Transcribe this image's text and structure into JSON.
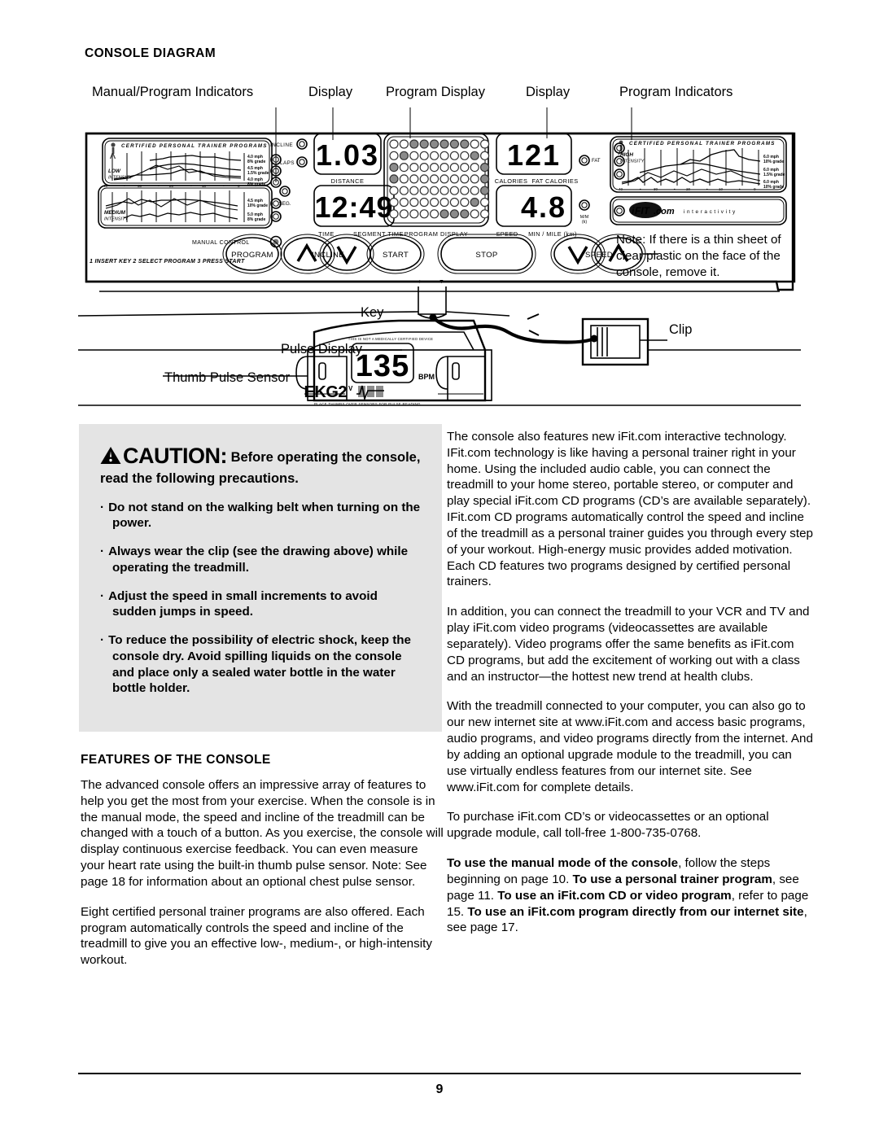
{
  "page": {
    "number": "9"
  },
  "sections": {
    "console_diagram_title": "CONSOLE DIAGRAM",
    "features_title": "FEATURES OF THE CONSOLE"
  },
  "callouts": {
    "manual_program_indicators": "Manual/Program Indicators",
    "display_left": "Display",
    "program_display": "Program Display",
    "display_right": "Display",
    "program_indicators": "Program Indicators",
    "key": "Key",
    "clip": "Clip",
    "pulse_display": "Pulse Display",
    "thumb_pulse_sensor": "Thumb Pulse Sensor"
  },
  "console": {
    "note": "Note: If there is a thin sheet of clear plastic on the face of the console, remove it.",
    "banner": "C E R T I F I E D   P E R S O N A L   T R A I N E R   P R O G R A M S",
    "instruction_strip": "1 INSERT KEY 2 SELECT PROGRAM 3 PRESS START",
    "manual_control_label": "MANUAL CONTROL",
    "intensity_low": "LOW",
    "intensity_low_sub": "INTENSITY",
    "intensity_medium": "MEDIUM",
    "intensity_medium_sub": "INTENSITY",
    "intensity_high": "HIGH",
    "intensity_high_sub": "INTENSITY",
    "ifit_logo": "iFIT.com",
    "ifit_tag": "i n t e r a c t i v i t y",
    "program_specs_low": [
      {
        "speed": "4.0 mph",
        "grade": "8% grade"
      },
      {
        "speed": "4.5 mph",
        "grade": "1.5% grade"
      },
      {
        "speed": "4.0 mph",
        "grade": "8% grade"
      }
    ],
    "program_specs_medium": [
      {
        "speed": "4.5 mph",
        "grade": "10% grade"
      },
      {
        "speed": "5.0 mph",
        "grade": "8% grade"
      }
    ],
    "program_specs_high": [
      {
        "speed": "6.0 mph",
        "grade": "10% grade"
      },
      {
        "speed": "6.0 mph",
        "grade": "1.5% grade"
      },
      {
        "speed": "6.0 mph",
        "grade": "10% grade"
      }
    ],
    "graph_axis_ticks": [
      "40",
      "30",
      "20",
      "10",
      "0"
    ],
    "indicator_labels": {
      "incline": "INCLINE",
      "laps": "LAPS",
      "seg": "SEG.",
      "fat": "FAT",
      "mm_k": "M/M (k)"
    },
    "displays": {
      "distance_value": "1.03",
      "distance_label": "DISTANCE",
      "time_value": "12:49",
      "time_label": "TIME",
      "segment_time_label": "SEGMENT TIME",
      "calories_value": "121",
      "calories_label": "CALORIES",
      "fat_calories_label": "FAT CALORIES",
      "speed_value": "4.8",
      "speed_label": "SPEED",
      "min_mile_label": "MIN / MILE (km)",
      "program_display_label": "PROGRAM DISPLAY"
    },
    "buttons": {
      "program": "PROGRAM",
      "incline": "INCLINE",
      "start": "START",
      "stop": "STOP",
      "speed": "SPEED"
    },
    "program_display_dots": [
      [
        0,
        0,
        1,
        1,
        1,
        1,
        1,
        1,
        0,
        0
      ],
      [
        0,
        1,
        0,
        0,
        0,
        0,
        0,
        0,
        1,
        0
      ],
      [
        1,
        0,
        0,
        0,
        0,
        0,
        0,
        0,
        0,
        1
      ],
      [
        1,
        0,
        0,
        0,
        0,
        0,
        0,
        0,
        0,
        1
      ],
      [
        0,
        0,
        0,
        0,
        0,
        0,
        0,
        0,
        0,
        1
      ],
      [
        0,
        0,
        0,
        0,
        0,
        0,
        0,
        0,
        1,
        0
      ],
      [
        0,
        0,
        0,
        0,
        0,
        1,
        1,
        1,
        0,
        0
      ]
    ]
  },
  "pulse": {
    "disclaimer": "THIS IS NOT A MEDICALLY CERTIFIED DEVICE",
    "value": "135",
    "unit": "BPM",
    "brand": "EKG2",
    "brand_sup": "V",
    "instruction": "PLACE THUMBS OVER SENSORS FOR PULSE READING"
  },
  "caution": {
    "word": "CAUTION:",
    "lead": " Before operating the console, read the following precautions.",
    "items": [
      "Do not stand on the walking belt when turning on the power.",
      "Always wear the clip (see the drawing above) while operating the treadmill.",
      "Adjust the speed in small increments to avoid sudden jumps in speed.",
      "To reduce the possibility of electric shock, keep the console dry. Avoid spilling liquids on the console and place only a sealed water bottle in the water bottle holder."
    ]
  },
  "left_column": {
    "p1": "The advanced console offers an impressive array of features to help you get the most from your exercise. When the console is in the manual mode, the speed and incline of the treadmill can be changed with a touch of a button. As you exercise, the console will display continuous exercise feedback. You can even measure your heart rate using the built-in thumb pulse sensor. Note: See page 18 for information about an optional chest pulse sensor.",
    "p2": "Eight certified personal trainer programs are also offered. Each program automatically controls the speed and incline of the treadmill to give you an effective low-, medium-, or high-intensity workout."
  },
  "right_column": {
    "p1": "The console also features new iFit.com interactive technology. IFit.com technology is like having a personal trainer right in your home. Using the included audio cable, you can connect the treadmill to your home stereo, portable stereo, or computer and play special iFit.com CD programs (CD’s are available separately). IFit.com CD programs automatically control the speed and incline of the treadmill as a personal trainer guides you through every step of your workout. High-energy music provides added motivation. Each CD features two programs designed by certified personal trainers.",
    "p2": "In addition, you can connect the treadmill to your VCR and TV and play iFit.com video programs (videocassettes are available separately). Video programs offer the same benefits as iFit.com CD programs, but add the excitement of working out with a class and an instructor—the hottest new trend at health clubs.",
    "p3": "With the treadmill connected to your computer, you can also go to our new internet site at www.iFit.com and access basic programs, audio programs, and video programs directly from the internet. And by adding an optional upgrade module to the treadmill, you can use virtually endless features from our internet site. See www.iFit.com for complete details.",
    "p4": "To purchase iFit.com CD’s or videocassettes or an optional upgrade module, call toll-free 1-800-735-0768.",
    "p5_b1": "To use the manual mode of the console",
    "p5_t1": ", follow the steps beginning on page 10. ",
    "p5_b2": "To use a personal trainer program",
    "p5_t2": ", see page 11. ",
    "p5_b3": "To use an iFit.com CD or video program",
    "p5_t3": ", refer to page 15. ",
    "p5_b4": "To use an iFit.com program directly from our internet site",
    "p5_t4": ", see page 17."
  }
}
